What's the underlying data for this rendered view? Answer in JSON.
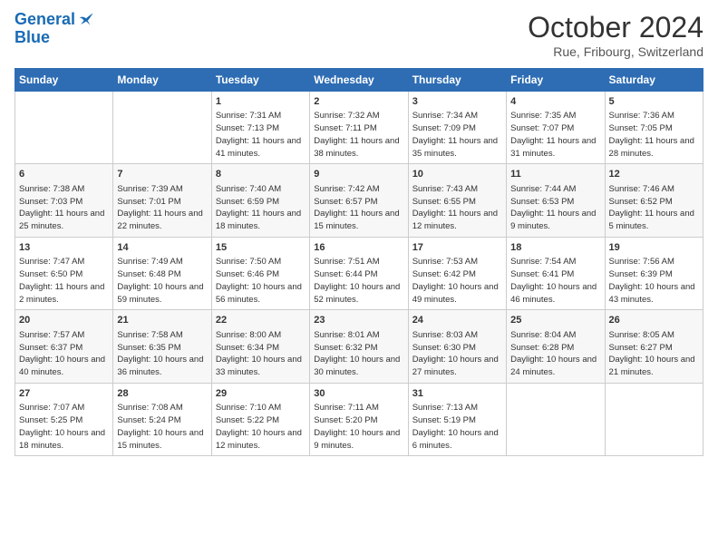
{
  "logo": {
    "line1": "General",
    "line2": "Blue"
  },
  "title": "October 2024",
  "location": "Rue, Fribourg, Switzerland",
  "weekdays": [
    "Sunday",
    "Monday",
    "Tuesday",
    "Wednesday",
    "Thursday",
    "Friday",
    "Saturday"
  ],
  "weeks": [
    [
      {
        "day": "",
        "sunrise": "",
        "sunset": "",
        "daylight": ""
      },
      {
        "day": "",
        "sunrise": "",
        "sunset": "",
        "daylight": ""
      },
      {
        "day": "1",
        "sunrise": "Sunrise: 7:31 AM",
        "sunset": "Sunset: 7:13 PM",
        "daylight": "Daylight: 11 hours and 41 minutes."
      },
      {
        "day": "2",
        "sunrise": "Sunrise: 7:32 AM",
        "sunset": "Sunset: 7:11 PM",
        "daylight": "Daylight: 11 hours and 38 minutes."
      },
      {
        "day": "3",
        "sunrise": "Sunrise: 7:34 AM",
        "sunset": "Sunset: 7:09 PM",
        "daylight": "Daylight: 11 hours and 35 minutes."
      },
      {
        "day": "4",
        "sunrise": "Sunrise: 7:35 AM",
        "sunset": "Sunset: 7:07 PM",
        "daylight": "Daylight: 11 hours and 31 minutes."
      },
      {
        "day": "5",
        "sunrise": "Sunrise: 7:36 AM",
        "sunset": "Sunset: 7:05 PM",
        "daylight": "Daylight: 11 hours and 28 minutes."
      }
    ],
    [
      {
        "day": "6",
        "sunrise": "Sunrise: 7:38 AM",
        "sunset": "Sunset: 7:03 PM",
        "daylight": "Daylight: 11 hours and 25 minutes."
      },
      {
        "day": "7",
        "sunrise": "Sunrise: 7:39 AM",
        "sunset": "Sunset: 7:01 PM",
        "daylight": "Daylight: 11 hours and 22 minutes."
      },
      {
        "day": "8",
        "sunrise": "Sunrise: 7:40 AM",
        "sunset": "Sunset: 6:59 PM",
        "daylight": "Daylight: 11 hours and 18 minutes."
      },
      {
        "day": "9",
        "sunrise": "Sunrise: 7:42 AM",
        "sunset": "Sunset: 6:57 PM",
        "daylight": "Daylight: 11 hours and 15 minutes."
      },
      {
        "day": "10",
        "sunrise": "Sunrise: 7:43 AM",
        "sunset": "Sunset: 6:55 PM",
        "daylight": "Daylight: 11 hours and 12 minutes."
      },
      {
        "day": "11",
        "sunrise": "Sunrise: 7:44 AM",
        "sunset": "Sunset: 6:53 PM",
        "daylight": "Daylight: 11 hours and 9 minutes."
      },
      {
        "day": "12",
        "sunrise": "Sunrise: 7:46 AM",
        "sunset": "Sunset: 6:52 PM",
        "daylight": "Daylight: 11 hours and 5 minutes."
      }
    ],
    [
      {
        "day": "13",
        "sunrise": "Sunrise: 7:47 AM",
        "sunset": "Sunset: 6:50 PM",
        "daylight": "Daylight: 11 hours and 2 minutes."
      },
      {
        "day": "14",
        "sunrise": "Sunrise: 7:49 AM",
        "sunset": "Sunset: 6:48 PM",
        "daylight": "Daylight: 10 hours and 59 minutes."
      },
      {
        "day": "15",
        "sunrise": "Sunrise: 7:50 AM",
        "sunset": "Sunset: 6:46 PM",
        "daylight": "Daylight: 10 hours and 56 minutes."
      },
      {
        "day": "16",
        "sunrise": "Sunrise: 7:51 AM",
        "sunset": "Sunset: 6:44 PM",
        "daylight": "Daylight: 10 hours and 52 minutes."
      },
      {
        "day": "17",
        "sunrise": "Sunrise: 7:53 AM",
        "sunset": "Sunset: 6:42 PM",
        "daylight": "Daylight: 10 hours and 49 minutes."
      },
      {
        "day": "18",
        "sunrise": "Sunrise: 7:54 AM",
        "sunset": "Sunset: 6:41 PM",
        "daylight": "Daylight: 10 hours and 46 minutes."
      },
      {
        "day": "19",
        "sunrise": "Sunrise: 7:56 AM",
        "sunset": "Sunset: 6:39 PM",
        "daylight": "Daylight: 10 hours and 43 minutes."
      }
    ],
    [
      {
        "day": "20",
        "sunrise": "Sunrise: 7:57 AM",
        "sunset": "Sunset: 6:37 PM",
        "daylight": "Daylight: 10 hours and 40 minutes."
      },
      {
        "day": "21",
        "sunrise": "Sunrise: 7:58 AM",
        "sunset": "Sunset: 6:35 PM",
        "daylight": "Daylight: 10 hours and 36 minutes."
      },
      {
        "day": "22",
        "sunrise": "Sunrise: 8:00 AM",
        "sunset": "Sunset: 6:34 PM",
        "daylight": "Daylight: 10 hours and 33 minutes."
      },
      {
        "day": "23",
        "sunrise": "Sunrise: 8:01 AM",
        "sunset": "Sunset: 6:32 PM",
        "daylight": "Daylight: 10 hours and 30 minutes."
      },
      {
        "day": "24",
        "sunrise": "Sunrise: 8:03 AM",
        "sunset": "Sunset: 6:30 PM",
        "daylight": "Daylight: 10 hours and 27 minutes."
      },
      {
        "day": "25",
        "sunrise": "Sunrise: 8:04 AM",
        "sunset": "Sunset: 6:28 PM",
        "daylight": "Daylight: 10 hours and 24 minutes."
      },
      {
        "day": "26",
        "sunrise": "Sunrise: 8:05 AM",
        "sunset": "Sunset: 6:27 PM",
        "daylight": "Daylight: 10 hours and 21 minutes."
      }
    ],
    [
      {
        "day": "27",
        "sunrise": "Sunrise: 7:07 AM",
        "sunset": "Sunset: 5:25 PM",
        "daylight": "Daylight: 10 hours and 18 minutes."
      },
      {
        "day": "28",
        "sunrise": "Sunrise: 7:08 AM",
        "sunset": "Sunset: 5:24 PM",
        "daylight": "Daylight: 10 hours and 15 minutes."
      },
      {
        "day": "29",
        "sunrise": "Sunrise: 7:10 AM",
        "sunset": "Sunset: 5:22 PM",
        "daylight": "Daylight: 10 hours and 12 minutes."
      },
      {
        "day": "30",
        "sunrise": "Sunrise: 7:11 AM",
        "sunset": "Sunset: 5:20 PM",
        "daylight": "Daylight: 10 hours and 9 minutes."
      },
      {
        "day": "31",
        "sunrise": "Sunrise: 7:13 AM",
        "sunset": "Sunset: 5:19 PM",
        "daylight": "Daylight: 10 hours and 6 minutes."
      },
      {
        "day": "",
        "sunrise": "",
        "sunset": "",
        "daylight": ""
      },
      {
        "day": "",
        "sunrise": "",
        "sunset": "",
        "daylight": ""
      }
    ]
  ]
}
